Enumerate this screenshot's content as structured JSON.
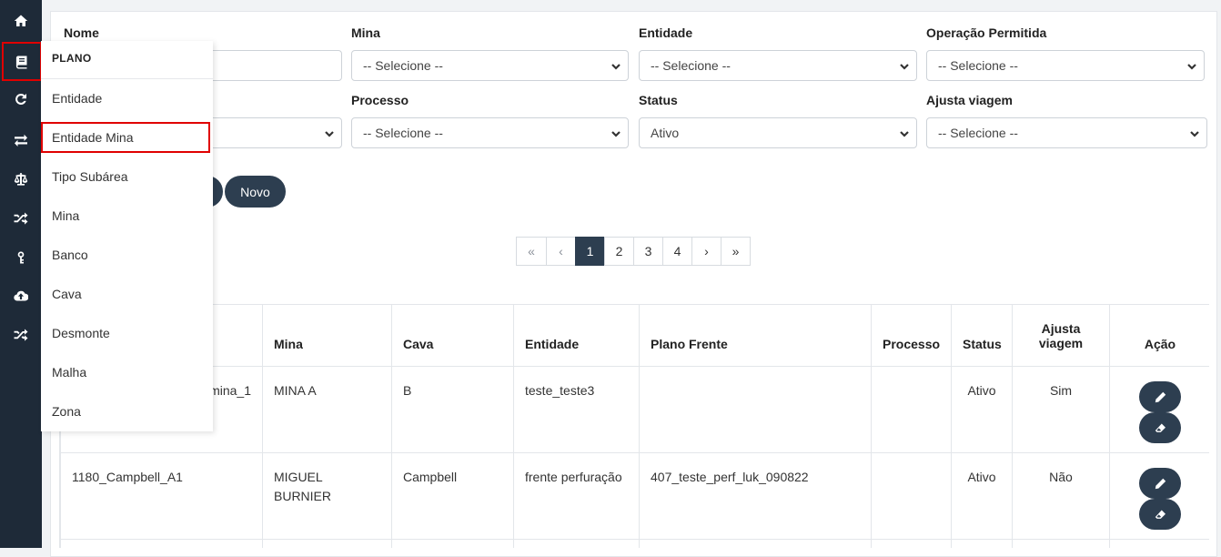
{
  "rail": {
    "icons": [
      "home-icon",
      "book-icon",
      "sync-icon",
      "transfer-icon",
      "balance-icon",
      "shuffle-icon",
      "key-icon",
      "cloud-upload-icon",
      "shuffle-icon"
    ]
  },
  "filters": {
    "nome_label": "Nome",
    "mina_label": "Mina",
    "mina_value": "-- Selecione --",
    "entidade_label": "Entidade",
    "entidade_value": "-- Selecione --",
    "operacao_label": "Operação Permitida",
    "operacao_value": "-- Selecione --",
    "processo_label": "Processo",
    "processo_value": "-- Selecione --",
    "status_label": "Status",
    "status_value": "Ativo",
    "ajusta_label": "Ajusta viagem",
    "ajusta_value": "-- Selecione --"
  },
  "actions": {
    "novo_label": "Novo"
  },
  "pagination": {
    "first": "«",
    "prev": "‹",
    "pages": [
      "1",
      "2",
      "3",
      "4"
    ],
    "next": "›",
    "last": "»",
    "active": "1"
  },
  "table": {
    "headers": {
      "mina": "Mina",
      "cava": "Cava",
      "entidade": "Entidade",
      "plano_frente": "Plano Frente",
      "processo": "Processo",
      "status": "Status",
      "ajusta_viagem": "Ajusta viagem",
      "acao": "Ação"
    },
    "rows": [
      {
        "nome": "mina_1",
        "mina": "MINA A",
        "cava": "B",
        "entidade": "teste_teste3",
        "plano_frente": "",
        "processo": "",
        "status": "Ativo",
        "ajusta_viagem": "Sim"
      },
      {
        "nome": "1180_Campbell_A1",
        "mina": "MIGUEL BURNIER",
        "cava": "Campbell",
        "entidade": "frente perfuração",
        "plano_frente": "407_teste_perf_luk_090822",
        "processo": "",
        "status": "Ativo",
        "ajusta_viagem": "Não"
      }
    ]
  },
  "flyout": {
    "title": "PLANO",
    "items": [
      "Entidade",
      "Entidade Mina",
      "Tipo Subárea",
      "Mina",
      "Banco",
      "Cava",
      "Desmonte",
      "Malha",
      "Zona"
    ]
  },
  "colors": {
    "rail": "#1e2a38",
    "accent": "#2d3e50",
    "highlight": "#e00000"
  }
}
